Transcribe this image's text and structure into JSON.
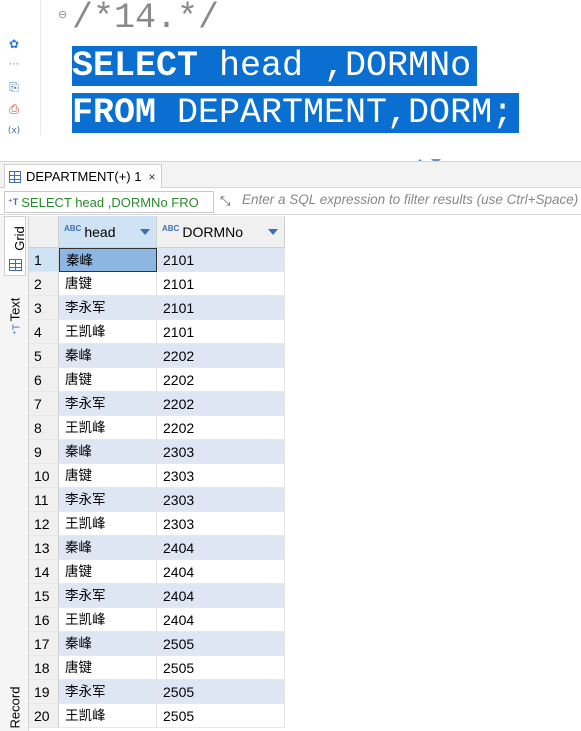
{
  "editor": {
    "comment": "/*14.*/",
    "line2_keyword": "SELECT",
    "line2_rest": " head ,DORMNo",
    "line3_keyword": "FROM",
    "line3_rest": " DEPARTMENT,DORM;"
  },
  "gutter_icons": [
    "settings-icon",
    "more-icon",
    "export-icon",
    "error-log-icon",
    "variables-icon"
  ],
  "results_tab": {
    "label": "DEPARTMENT(+) 1",
    "close": "×"
  },
  "filter": {
    "query": "SELECT head ,DORMNo FRO",
    "placeholder": "Enter a SQL expression to filter results (use Ctrl+Space)"
  },
  "side_tabs": {
    "grid": "Grid",
    "text": "Text",
    "record": "Record"
  },
  "columns": [
    {
      "type_badge": "ABC",
      "name": "head"
    },
    {
      "type_badge": "ABC",
      "name": "DORMNo"
    }
  ],
  "rows": [
    {
      "n": "1",
      "head": "秦峰",
      "dorm": "2101"
    },
    {
      "n": "2",
      "head": "唐键",
      "dorm": "2101"
    },
    {
      "n": "3",
      "head": "李永军",
      "dorm": "2101"
    },
    {
      "n": "4",
      "head": "王凯峰",
      "dorm": "2101"
    },
    {
      "n": "5",
      "head": "秦峰",
      "dorm": "2202"
    },
    {
      "n": "6",
      "head": "唐键",
      "dorm": "2202"
    },
    {
      "n": "7",
      "head": "李永军",
      "dorm": "2202"
    },
    {
      "n": "8",
      "head": "王凯峰",
      "dorm": "2202"
    },
    {
      "n": "9",
      "head": "秦峰",
      "dorm": "2303"
    },
    {
      "n": "10",
      "head": "唐键",
      "dorm": "2303"
    },
    {
      "n": "11",
      "head": "李永军",
      "dorm": "2303"
    },
    {
      "n": "12",
      "head": "王凯峰",
      "dorm": "2303"
    },
    {
      "n": "13",
      "head": "秦峰",
      "dorm": "2404"
    },
    {
      "n": "14",
      "head": "唐键",
      "dorm": "2404"
    },
    {
      "n": "15",
      "head": "李永军",
      "dorm": "2404"
    },
    {
      "n": "16",
      "head": "王凯峰",
      "dorm": "2404"
    },
    {
      "n": "17",
      "head": "秦峰",
      "dorm": "2505"
    },
    {
      "n": "18",
      "head": "唐键",
      "dorm": "2505"
    },
    {
      "n": "19",
      "head": "李永军",
      "dorm": "2505"
    },
    {
      "n": "20",
      "head": "王凯峰",
      "dorm": "2505"
    }
  ],
  "colors": {
    "selection": "#0b6fd1",
    "row_alt": "#dde6f2",
    "selected_cell": "#8db7e3"
  }
}
